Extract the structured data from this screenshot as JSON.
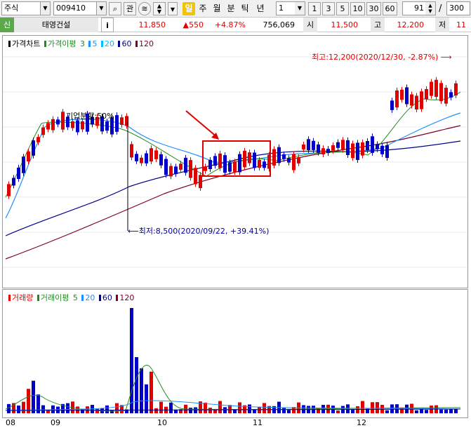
{
  "toolbar": {
    "market": "주식",
    "code": "009410",
    "buttons": [
      "관"
    ],
    "periods": [
      "일",
      "주",
      "월",
      "분",
      "틱",
      "년"
    ],
    "active_period": "일",
    "interval_value": "1",
    "quick_intervals": [
      "1",
      "3",
      "5",
      "10",
      "30",
      "60"
    ],
    "count_value": "91",
    "slash": "/",
    "total_value": "300"
  },
  "info": {
    "badge": "신",
    "name": "태영건설",
    "info_btn": "i",
    "price": "11,850",
    "change": "▲550",
    "change_pct": "+4.87%",
    "volume": "756,069",
    "open_label": "시",
    "open": "11,500",
    "high_label": "고",
    "high": "12,200",
    "low_label": "저",
    "low": "11"
  },
  "price_panel": {
    "legend_main": "가격차트",
    "legend_ma_label": "가격이평",
    "legend_periods": [
      "3",
      "5",
      "20",
      "60",
      "120"
    ],
    "high_note": "최고:12,200(2020/12/30, -2.87%)",
    "low_note": "최저:8,500(2020/09/22, +39.41%)",
    "split_note": "기업분할:50%"
  },
  "volume_panel": {
    "legend_main": "거래량",
    "legend_ma_label": "거래이평",
    "legend_periods": [
      "5",
      "20",
      "60",
      "120"
    ]
  },
  "x_axis": [
    "08",
    "09",
    "10",
    "11",
    "12"
  ],
  "colors": {
    "up": "#e00000",
    "down": "#0000c8",
    "ma3": "#e00000",
    "ma5": "#228b22",
    "ma20": "#1e90ff",
    "ma60": "#00008b",
    "ma120": "#800020"
  }
}
